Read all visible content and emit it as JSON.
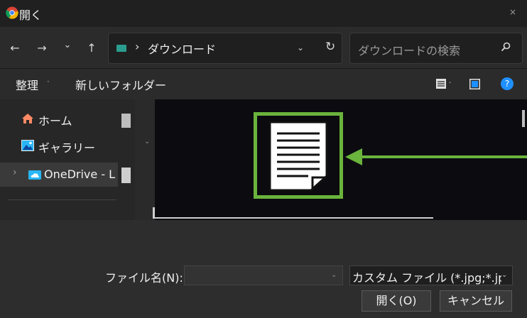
{
  "window": {
    "title": "開く",
    "close_glyph": "×"
  },
  "nav": {
    "back": "←",
    "forward": "→",
    "recent": "⌄",
    "up": "↑",
    "address_sep": "›",
    "address": "ダウンロード",
    "address_dropdown": "⌄",
    "refresh": "↻",
    "search_placeholder": "ダウンロードの検索"
  },
  "toolbar": {
    "organize": "整理",
    "organize_dd": "·",
    "new_folder": "新しいフォルダー",
    "view_dd": "·",
    "help": "?"
  },
  "sidebar": {
    "items": [
      {
        "label": "ホーム",
        "icon": "home-icon"
      },
      {
        "label": "ギャラリー",
        "icon": "gallery-icon"
      },
      {
        "label": "OneDrive - L",
        "icon": "cloud-icon",
        "selected": true
      }
    ],
    "expand_glyph": "›"
  },
  "bottom": {
    "filename_label": "ファイル名(N):",
    "filename_value": "",
    "filter": "カスタム ファイル (*.jpg;*.jpe",
    "open": "開く(O)",
    "cancel": "キャンセル"
  },
  "colors": {
    "highlight": "#6ab33c",
    "arrow": "#6ab33c",
    "accent": "#1e90ff"
  }
}
